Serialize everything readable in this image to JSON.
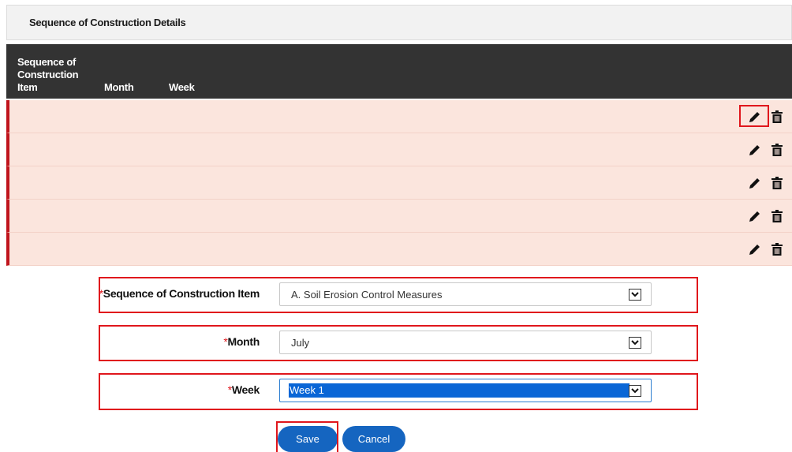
{
  "section": {
    "title": "Sequence of Construction Details"
  },
  "grid": {
    "columns": [
      "Sequence of Construction Item",
      "Month",
      "Week"
    ],
    "row_count": 5
  },
  "form": {
    "item_label": "Sequence of Construction Item",
    "item_value": "A. Soil Erosion Control Measures",
    "month_label": "Month",
    "month_value": "July",
    "week_label": "Week",
    "week_value": "Week 1",
    "required_mark": "*"
  },
  "buttons": {
    "save": "Save",
    "cancel": "Cancel"
  },
  "colors": {
    "row_bg": "#fbe5dd",
    "row_accent": "#c0141c",
    "header_bg": "#333333",
    "primary": "#1565c0",
    "highlight": "#e0161c"
  },
  "icons": {
    "edit": "pencil-icon",
    "delete": "trash-icon",
    "dropdown": "chevron-down-icon"
  }
}
